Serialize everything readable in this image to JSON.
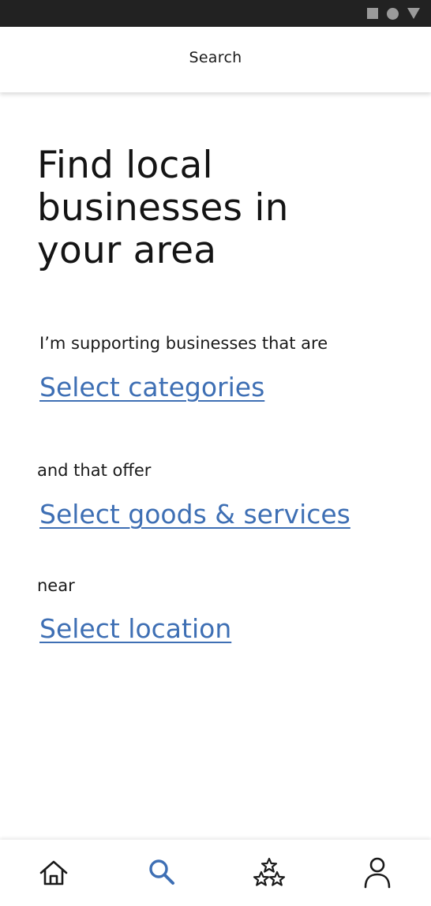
{
  "app_bar": {
    "title": "Search"
  },
  "headline": "Find local businesses in your area",
  "form": {
    "categories_prompt": "I’m supporting businesses that are",
    "categories_link": "Select categories",
    "goods_prompt": "and that offer",
    "goods_link": "Select goods & services",
    "location_prompt": "near",
    "location_link": "Select location"
  },
  "colors": {
    "link": "#3e6fb4",
    "active_nav": "#3e6fb4",
    "status_bar": "#222222"
  },
  "bottom_nav": {
    "items": [
      {
        "icon": "home-icon",
        "active": false
      },
      {
        "icon": "search-icon",
        "active": true
      },
      {
        "icon": "stars-icon",
        "active": false
      },
      {
        "icon": "profile-icon",
        "active": false
      }
    ]
  }
}
